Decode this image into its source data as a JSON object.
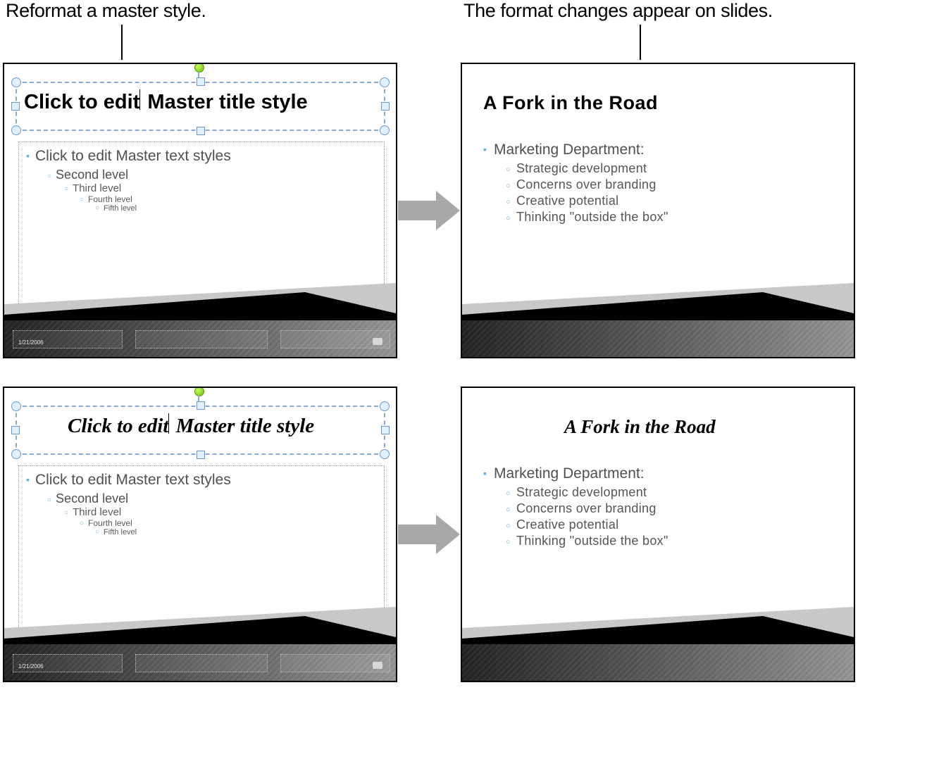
{
  "captions": {
    "left": "Reformat a master style.",
    "right": "The format changes appear on slides."
  },
  "master": {
    "title_text": "Click to edit Master title style",
    "title_before": "Click to edit",
    "title_after": "Master title style",
    "levels": {
      "l1": "Click to edit Master text styles",
      "l2": "Second level",
      "l3": "Third level",
      "l4": "Fourth level",
      "l5": "Fifth level"
    },
    "date": "1/21/2006"
  },
  "result": {
    "title": "A Fork in the Road",
    "l1": "Marketing Department:",
    "items": [
      "Strategic development",
      "Concerns over branding",
      "Creative potential",
      "Thinking \"outside the box\""
    ]
  },
  "icons": {
    "rotate": "rotate-handle-icon",
    "arrow": "arrow-right-icon",
    "page_num": "page-number-icon"
  },
  "colors": {
    "accent": "#5fb3da",
    "selection": "#8aa9ce"
  }
}
